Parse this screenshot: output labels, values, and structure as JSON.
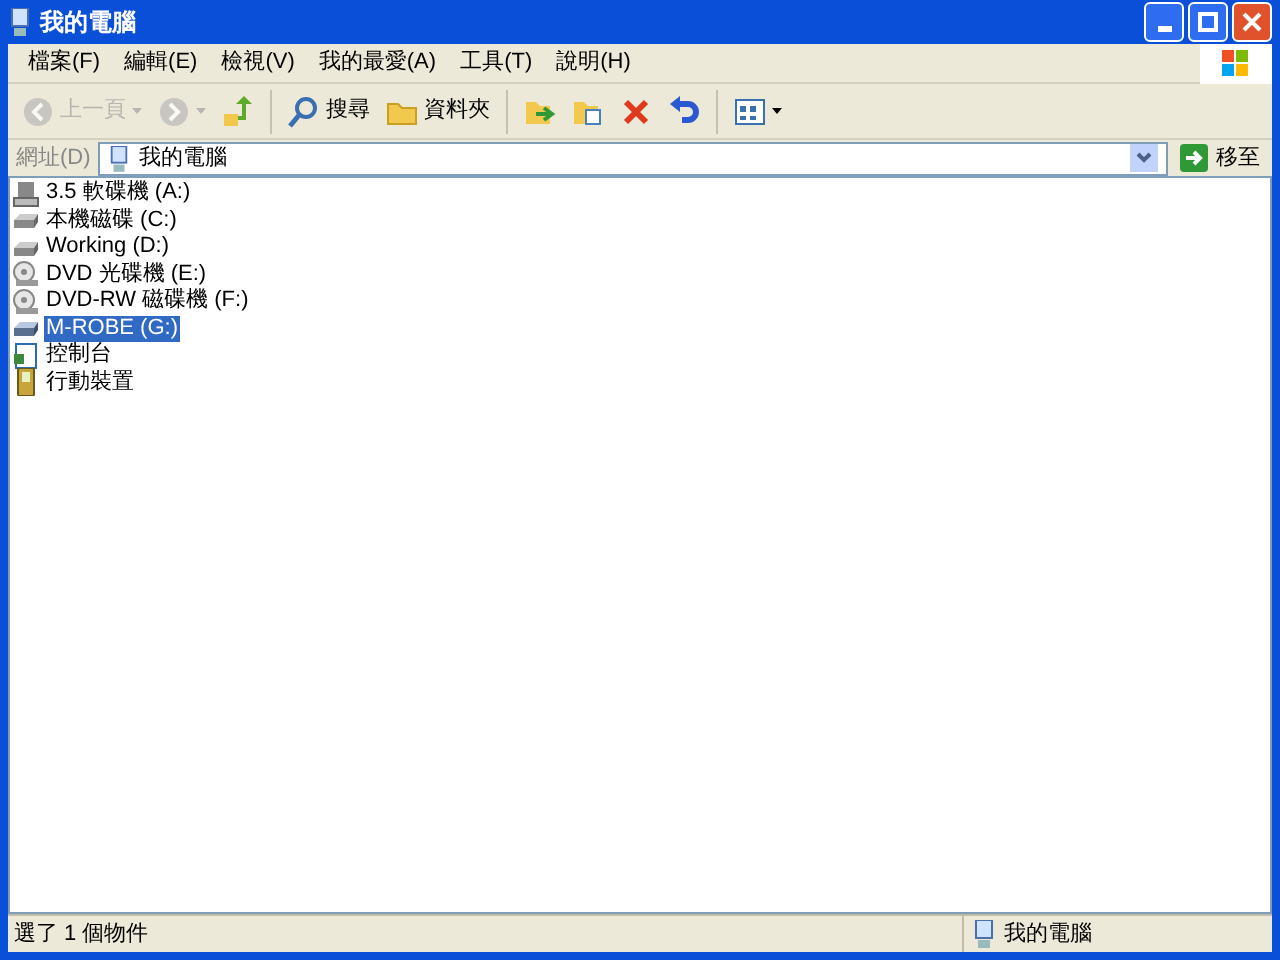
{
  "window": {
    "title": "我的電腦"
  },
  "menu": [
    "檔案(F)",
    "編輯(E)",
    "檢視(V)",
    "我的最愛(A)",
    "工具(T)",
    "說明(H)"
  ],
  "toolbar": [
    {
      "kind": "back",
      "label": "上一頁",
      "disabled": true
    },
    {
      "kind": "forward",
      "disabled": true
    },
    {
      "kind": "up",
      "disabled": false
    },
    {
      "kind": "search",
      "label": "搜尋",
      "disabled": false
    },
    {
      "kind": "folders",
      "label": "資料夾",
      "disabled": false
    },
    {
      "kind": "move",
      "disabled": false
    },
    {
      "kind": "copy",
      "disabled": false
    },
    {
      "kind": "delete",
      "disabled": false
    },
    {
      "kind": "undo",
      "disabled": false
    },
    {
      "kind": "views",
      "disabled": false
    }
  ],
  "address": {
    "label": "網址(D)",
    "value": "我的電腦",
    "go": "移至"
  },
  "items": [
    {
      "kind": "floppy",
      "label": "3.5 軟碟機 (A:)",
      "selected": false
    },
    {
      "kind": "disk",
      "label": "本機磁碟 (C:)",
      "selected": false
    },
    {
      "kind": "disk",
      "label": "Working (D:)",
      "selected": false
    },
    {
      "kind": "cd",
      "label": "DVD 光碟機 (E:)",
      "selected": false
    },
    {
      "kind": "cd",
      "label": "DVD-RW 磁碟機 (F:)",
      "selected": false
    },
    {
      "kind": "removable",
      "label": "M-ROBE (G:)",
      "selected": true
    },
    {
      "kind": "control",
      "label": "控制台",
      "selected": false
    },
    {
      "kind": "device",
      "label": "行動裝置",
      "selected": false
    }
  ],
  "status_bar": {
    "message": "選了 1 個物件",
    "location": "我的電腦"
  }
}
